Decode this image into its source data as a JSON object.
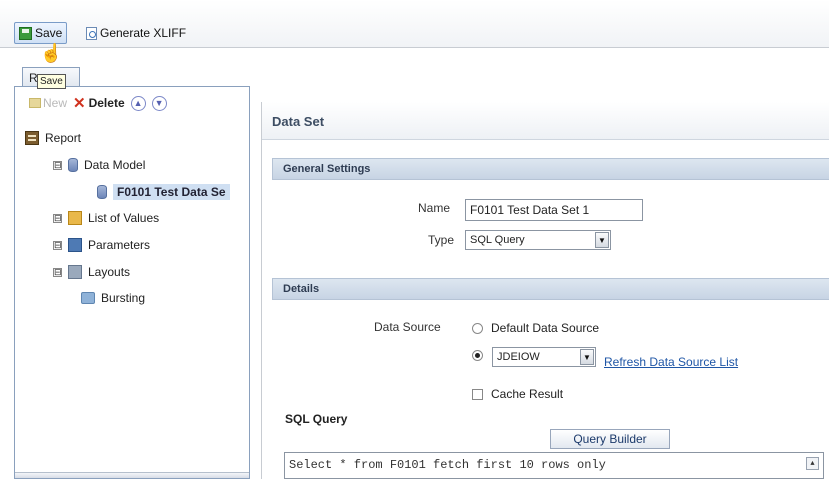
{
  "toolbar": {
    "save_label": "Save",
    "generate_xliff_label": "Generate XLIFF",
    "tooltip": "Save",
    "tab_initial": "R"
  },
  "left": {
    "new_label": "New",
    "delete_label": "Delete",
    "tree": {
      "report": "Report",
      "data_model": "Data Model",
      "dataset": "F0101 Test Data Se",
      "list_of_values": "List of Values",
      "parameters": "Parameters",
      "layouts": "Layouts",
      "bursting": "Bursting"
    },
    "expander_symbol": "⊟"
  },
  "right": {
    "header": "Data Set",
    "general_settings": "General Settings",
    "name_label": "Name",
    "name_value": "F0101 Test Data Set 1",
    "type_label": "Type",
    "type_value": "SQL Query",
    "details": "Details",
    "data_source_label": "Data Source",
    "default_data_source": "Default Data Source",
    "data_source_value": "JDEIOW",
    "refresh_link": "Refresh Data Source List",
    "cache_result": "Cache Result",
    "sql_query_title": "SQL Query",
    "query_builder": "Query Builder",
    "sql_text": "Select * from F0101 fetch first 10 rows only"
  },
  "icons": {
    "cursor": "hand-pointer-icon",
    "up": "up-arrow-circle-icon",
    "down": "down-arrow-circle-icon"
  }
}
